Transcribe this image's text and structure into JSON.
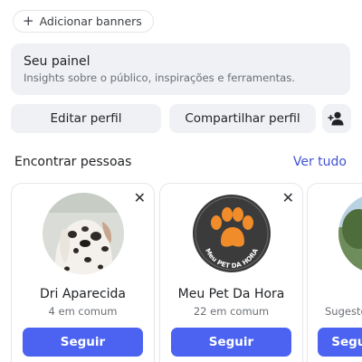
{
  "banner_button": {
    "label": "Adicionar banners",
    "icon": "plus-icon"
  },
  "panel": {
    "title": "Seu painel",
    "subtitle": "Insights sobre o público, inspirações e ferramentas."
  },
  "actions": {
    "edit_profile": "Editar perfil",
    "share_profile": "Compartilhar perfil",
    "add_user_icon": "add-user-icon"
  },
  "discover": {
    "title": "Encontrar pessoas",
    "see_all": "Ver tudo",
    "cards": [
      {
        "name": "Dri Aparecida",
        "mutual": "4 em comum",
        "follow": "Seguir",
        "dismiss_icon": "close-icon"
      },
      {
        "name": "Meu Pet Da Hora",
        "mutual": "22 em comum",
        "follow": "Seguir",
        "dismiss_icon": "close-icon",
        "logo_text": "Meu PET DA HORA"
      },
      {
        "name": "",
        "mutual": "Sugestõ",
        "follow": "Seguir"
      }
    ]
  },
  "colors": {
    "accent": "#4b63f0",
    "link": "#4152d4",
    "surface": "#eff1f4",
    "logo_orange": "#f08c2a",
    "logo_dark": "#3a3a3a"
  }
}
